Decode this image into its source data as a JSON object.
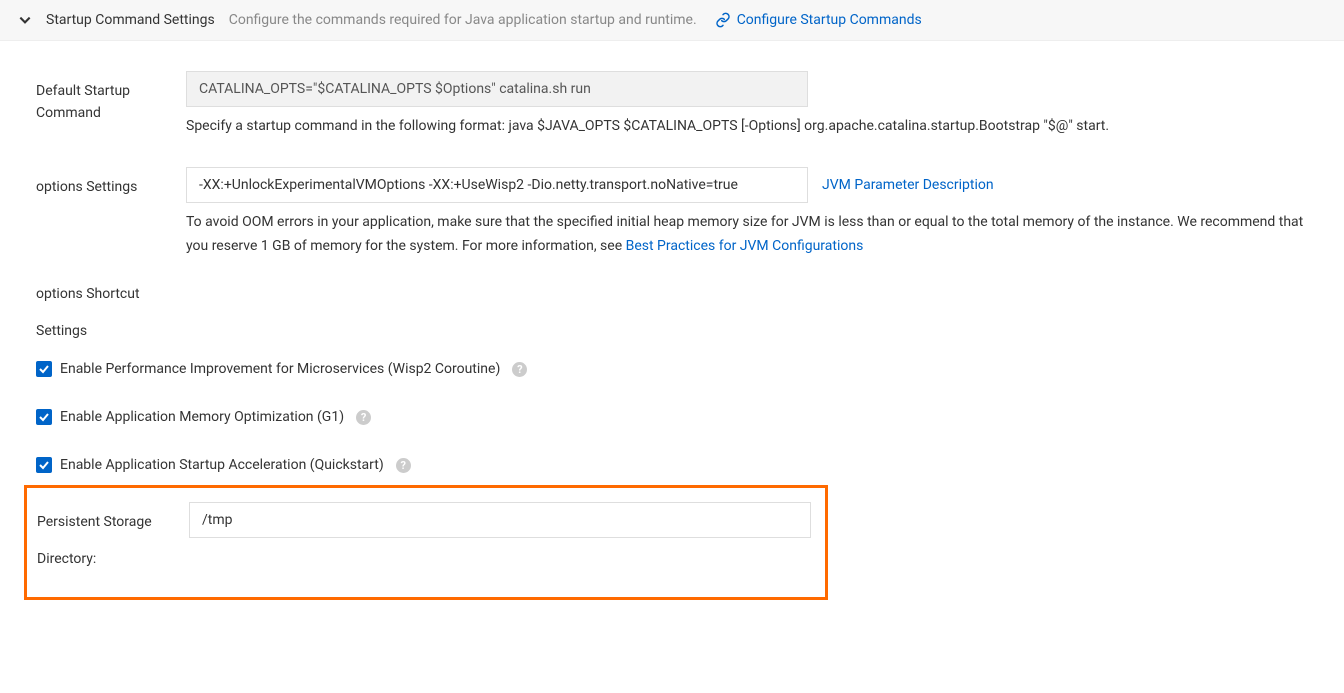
{
  "header": {
    "title": "Startup Command Settings",
    "description": "Configure the commands required for Java application startup and runtime.",
    "link_label": "Configure Startup Commands"
  },
  "form": {
    "default_startup": {
      "label": "Default Startup Command",
      "value": "CATALINA_OPTS=\"$CATALINA_OPTS $Options\" catalina.sh run",
      "help": "Specify a startup command in the following format: java $JAVA_OPTS $CATALINA_OPTS [-Options] org.apache.catalina.startup.Bootstrap \"$@\" start."
    },
    "options_settings": {
      "label": "options Settings",
      "value": "-XX:+UnlockExperimentalVMOptions -XX:+UseWisp2 -Dio.netty.transport.noNative=true",
      "side_link": "JVM Parameter Description",
      "help_prefix": "To avoid OOM errors in your application, make sure that the specified initial heap memory size for JVM is less than or equal to the total memory of the instance. We recommend that you reserve 1 GB of memory for the system. For more information, see ",
      "help_link": "Best Practices for JVM Configurations"
    },
    "shortcut": {
      "label": "options Shortcut Settings",
      "checkboxes": [
        {
          "label": "Enable Performance Improvement for Microservices (Wisp2 Coroutine)",
          "checked": true
        },
        {
          "label": "Enable Application Memory Optimization (G1)",
          "checked": true
        },
        {
          "label": "Enable Application Startup Acceleration (Quickstart)",
          "checked": true
        }
      ]
    },
    "storage": {
      "label": "Persistent Storage Directory:",
      "value": "/tmp"
    }
  }
}
